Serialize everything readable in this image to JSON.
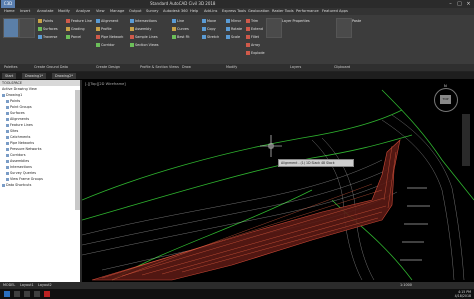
{
  "title": "Standard AutoCAD Civil 3D 2018",
  "app_button": "C3D",
  "menu": [
    "Home",
    "Insert",
    "Annotate",
    "Modify",
    "Analyze",
    "View",
    "Manage",
    "Output",
    "Survey",
    "Autodesk 360",
    "Help",
    "Add-ins",
    "Express Tools",
    "Geolocation",
    "Raster Tools",
    "Performance",
    "Featured Apps"
  ],
  "ribbon": {
    "col1": [
      "Points",
      "Surfaces",
      "Traverse"
    ],
    "col2": [
      "Feature Line",
      "Grading",
      "Parcel"
    ],
    "col3": [
      "Alignment",
      "Profile",
      "Pipe Network",
      "Corridor"
    ],
    "col4": [
      "Intersections",
      "Assembly",
      "Sample Lines",
      "Section Views"
    ],
    "col5": [
      "Line",
      "Curves",
      "Best Fit"
    ],
    "col6": [
      "Move",
      "Copy",
      "Stretch",
      "Mirror",
      "Rotate",
      "Scale"
    ],
    "col7": [
      "Trim",
      "Extend",
      "Fillet",
      "Array",
      "Explode"
    ],
    "layers_btn": "Layer Properties",
    "clipboard": "Paste"
  },
  "panels": [
    "Palettes",
    "Create Ground Data",
    "Create Design",
    "Profile & Section Views",
    "Draw",
    "Modify",
    "Layers",
    "Clipboard"
  ],
  "doc_tabs": [
    "Start",
    "Drawing1*",
    "Drawing2*"
  ],
  "toolspace": {
    "header": "TOOLSPACE",
    "view_label": "Active Drawing View",
    "items": [
      "Drawing1",
      "Points",
      "Point Groups",
      "Surfaces",
      "Alignments",
      "Feature Lines",
      "Sites",
      "Catchments",
      "Pipe Networks",
      "Pressure Networks",
      "Corridors",
      "Assemblies",
      "Intersections",
      "Survey Queries",
      "View Frame Groups",
      "Data Shortcuts"
    ]
  },
  "viewport_label": "[-][Top][2D Wireframe]",
  "tooltip": "Alignment - (1)   1D   Slack 48   Slack",
  "viewcube": {
    "label": "N",
    "face": "TOP"
  },
  "status": {
    "model": "MODEL",
    "layout1": "Layout1",
    "layout2": "Layout2",
    "scale": "1:1000"
  },
  "clock": {
    "time": "4:15 PM",
    "date": "4/18/2018"
  }
}
